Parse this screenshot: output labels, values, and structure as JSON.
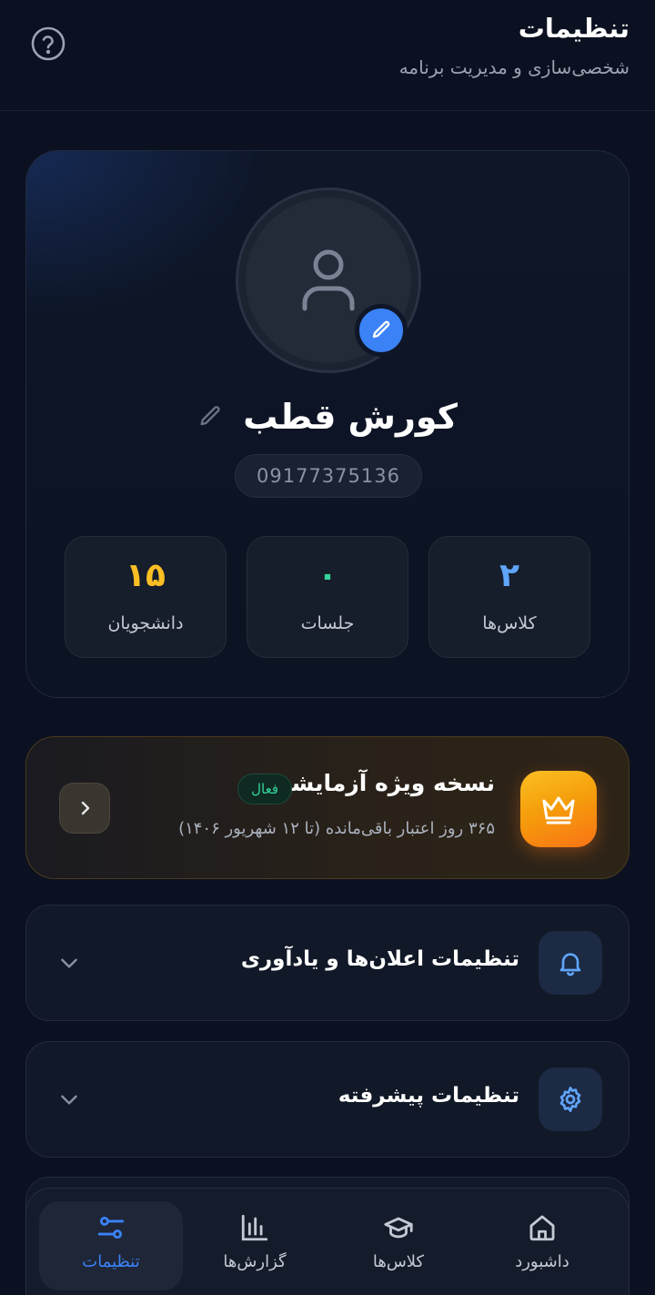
{
  "header": {
    "title": "تنظیمات",
    "subtitle": "شخصی‌سازی و مدیریت برنامه",
    "help_icon": "help-circle-icon"
  },
  "profile": {
    "name": "کورش قطب",
    "phone": "09177375136",
    "avatar_icon": "user-icon",
    "stats": [
      {
        "value": "۲",
        "label": "کلاس‌ها",
        "color": "#60a5fa"
      },
      {
        "value": "۰",
        "label": "جلسات",
        "color": "#34d399"
      },
      {
        "value": "۱۵",
        "label": "دانشجویان",
        "color": "#fbbf24"
      }
    ]
  },
  "premium": {
    "title": "نسخه ویژه آزمایشی",
    "badge": "فعال",
    "subtitle": "۳۶۵ روز اعتبار باقی‌مانده (تا ۱۲ شهریور ۱۴۰۶)",
    "icon": "crown-icon"
  },
  "sections": [
    {
      "title": "تنظیمات اعلان‌ها و یادآوری",
      "icon": "bell-icon"
    },
    {
      "title": "تنظیمات پیشرفته",
      "icon": "gear-icon"
    }
  ],
  "nav": {
    "items": [
      {
        "label": "داشبورد",
        "icon": "home-icon",
        "active": false
      },
      {
        "label": "کلاس‌ها",
        "icon": "graduation-cap-icon",
        "active": false
      },
      {
        "label": "گزارش‌ها",
        "icon": "bar-chart-icon",
        "active": false
      },
      {
        "label": "تنظیمات",
        "icon": "sliders-icon",
        "active": true
      }
    ]
  },
  "colors": {
    "accent": "#3b82f6",
    "background": "#0b1120",
    "premium_orange": "#f59e0b",
    "active_green": "#34d399"
  }
}
